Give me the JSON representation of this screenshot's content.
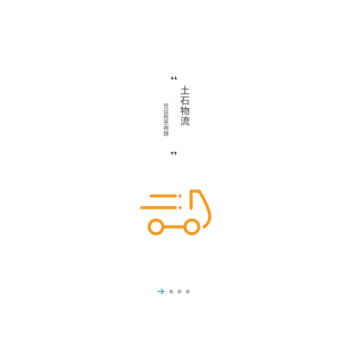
{
  "splash": {
    "title": "土石物流",
    "subtitle": "货运抢单神器",
    "quote_open": "❛❛",
    "quote_close": "❜❜"
  },
  "pager": {
    "current_index": 0,
    "total": 4
  },
  "colors": {
    "accent": "#f39a1e",
    "arrow": "#2fa7b5",
    "text": "#333333",
    "dot_inactive": "#b0b0b0"
  },
  "icons": {
    "logo": "truck-icon",
    "next": "arrow-right-icon"
  }
}
